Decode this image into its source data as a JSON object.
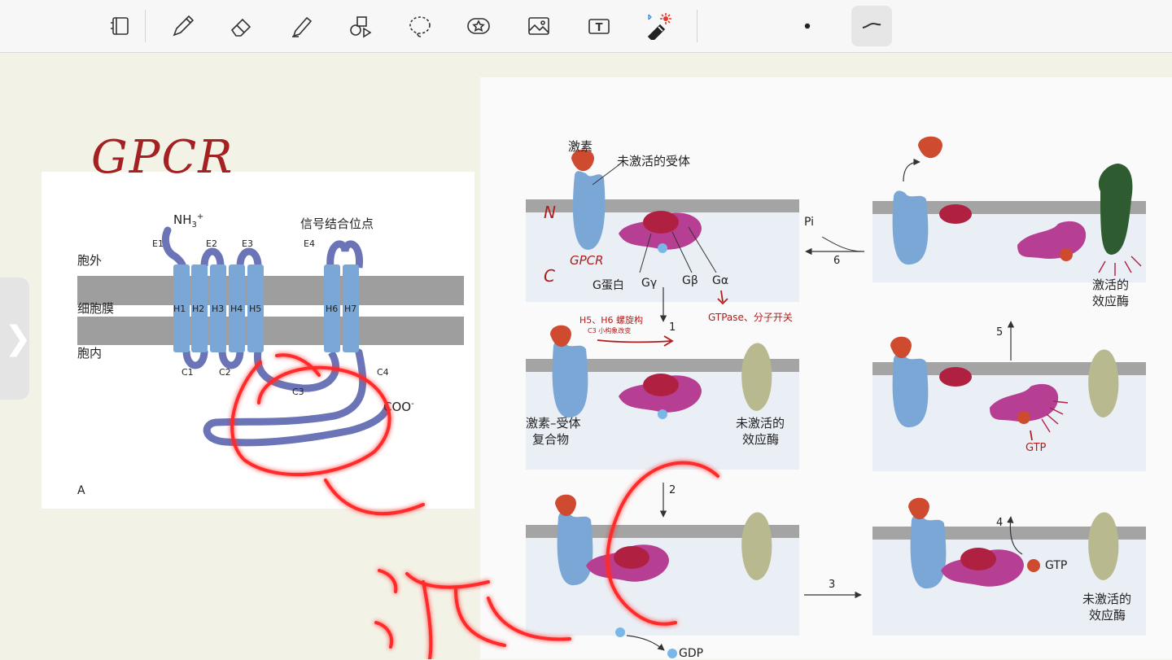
{
  "toolbar": {
    "tools": [
      {
        "name": "lasso-page-tool-icon"
      },
      {
        "name": "pen-tool-icon"
      },
      {
        "name": "eraser-tool-icon"
      },
      {
        "name": "highlighter-tool-icon"
      },
      {
        "name": "shapes-tool-icon"
      },
      {
        "name": "lasso-select-tool-icon"
      },
      {
        "name": "sticker-tool-icon"
      },
      {
        "name": "image-tool-icon"
      },
      {
        "name": "text-tool-icon"
      },
      {
        "name": "laser-pointer-tool-icon"
      },
      {
        "name": "pen-size-dot-icon"
      },
      {
        "name": "stroke-style-icon"
      }
    ],
    "text_tool_glyph": "T",
    "colors": {
      "bluetooth": "#2f7ee0",
      "laser": "#e53a2b"
    }
  },
  "left_figure": {
    "handwritten_title": "GPCR",
    "extracellular": "胞外",
    "membrane": "细胞膜",
    "intracellular": "胞内",
    "n_terminus": "NH",
    "n_sub": "3",
    "n_sup": "+",
    "binding_site": "信号结合位点",
    "extra_loops": [
      "E1",
      "E2",
      "E3",
      "E4"
    ],
    "helices": [
      "H1",
      "H2",
      "H3",
      "H4",
      "H5",
      "H6",
      "H7"
    ],
    "intra_loops": [
      "C1",
      "C2",
      "C3",
      "C4"
    ],
    "c_terminus": "COO",
    "c_sup": "-",
    "panel_letter": "A"
  },
  "right_figure": {
    "hormone": "激素",
    "inactive_receptor": "未激活的受体",
    "g_protein": "G蛋白",
    "g_gamma": "Gγ",
    "g_beta": "Gβ",
    "g_alpha": "Gα",
    "hormone_receptor_complex_line1": "激素–受体",
    "hormone_receptor_complex_line2": "复合物",
    "inactive_effector_line1": "未激活的",
    "inactive_effector_line2": "效应酶",
    "active_effector_line1": "激活的",
    "active_effector_line2": "效应酶",
    "gdp": "GDP",
    "gtp": "GTP",
    "pi": "Pi",
    "steps": [
      "1",
      "2",
      "3",
      "4",
      "5",
      "6"
    ]
  },
  "annotations": {
    "n_mark": "N",
    "c_mark": "C",
    "gpcr_mark": "GPCR",
    "h5h6_note": "H5、H6 螺旋构",
    "h5h6_note2": "C3 小构象改变",
    "galpha_note": "GTPase、分子开关",
    "gtp_mark": "GTP",
    "big_char": "激"
  },
  "colors": {
    "page": "#f3f2e6",
    "membrane": "#9e9e9e",
    "receptor_blue": "#7ba7d6",
    "loop_purple": "#6b74b6",
    "hormone": "#cf4b2f",
    "g_alpha": "#b63f93",
    "g_beta": "#b02040",
    "effector_inactive": "#b8b98e",
    "effector_active": "#2f5b31",
    "ink_red": "#b21c1c",
    "neon_red": "#ff1e1e"
  }
}
